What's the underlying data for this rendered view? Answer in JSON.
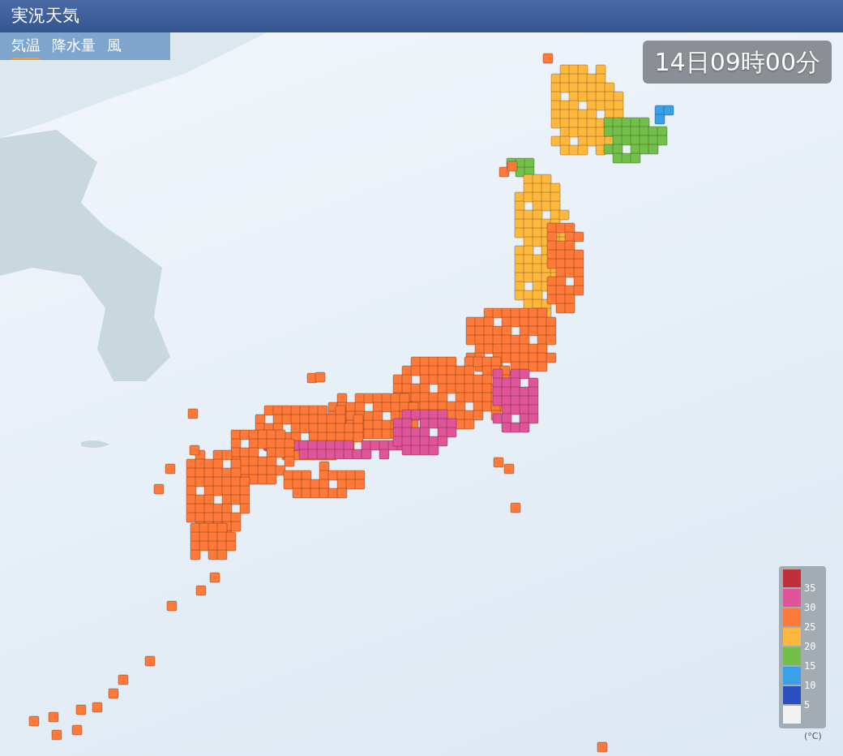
{
  "header": {
    "title": "実況天気"
  },
  "tabs": [
    {
      "label": "気温",
      "selected": true
    },
    {
      "label": "降水量",
      "selected": false
    },
    {
      "label": "風",
      "selected": false
    }
  ],
  "timestamp": "14日09時00分",
  "legend": {
    "items": [
      {
        "label": "35",
        "color": "#c0303a"
      },
      {
        "label": "30",
        "color": "#e0559a"
      },
      {
        "label": "25",
        "color": "#ff7a38"
      },
      {
        "label": "20",
        "color": "#ffb83e"
      },
      {
        "label": "15",
        "color": "#72c04a"
      },
      {
        "label": "10",
        "color": "#3aa0e8"
      },
      {
        "label": "5",
        "color": "#2a4fc0"
      },
      {
        "color": "#f2f2f2"
      }
    ],
    "unit": "(°C)"
  }
}
